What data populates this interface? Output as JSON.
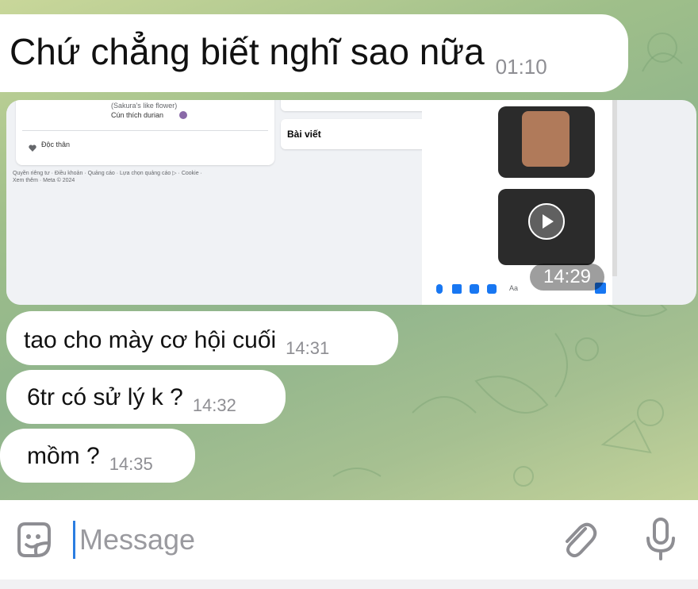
{
  "messages": {
    "top": {
      "text": "Chứ chẳng biết nghĩ sao nữa",
      "time": "01:10"
    },
    "image": {
      "time": "14:29",
      "screenshot": {
        "card_line1": "(Sakura's like flower)",
        "card_line2": "Cún thích durian",
        "status": "Độc thân",
        "posts_tab": "Bài viết",
        "footer_line1": "Quyền riêng tư · Điều khoản · Quảng cáo · Lựa chọn quảng cáo ▷ · Cookie ·",
        "footer_line2": "Xem thêm · Meta © 2024",
        "composer_placeholder": "Aa"
      }
    },
    "list": [
      {
        "text": "tao cho mày cơ hội cuối",
        "time": "14:31"
      },
      {
        "text": "6tr có sử lý k ?",
        "time": "14:32"
      },
      {
        "text": "mồm ?",
        "time": "14:35"
      }
    ]
  },
  "composer": {
    "placeholder": "Message"
  },
  "icons": {
    "sticker": "sticker-icon",
    "attach": "paperclip-icon",
    "mic": "microphone-icon"
  },
  "colors": {
    "bubble": "#ffffff",
    "time": "#8e8e93",
    "accent": "#2b7de1"
  }
}
